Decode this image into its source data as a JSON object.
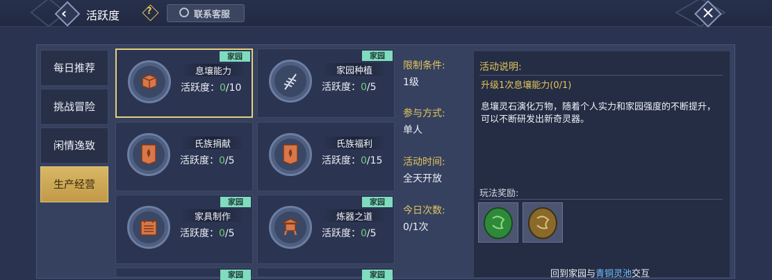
{
  "header": {
    "title": "活跃度",
    "contact_label": "联系客服"
  },
  "sidebar": {
    "tabs": [
      {
        "label": "每日推荐",
        "active": false
      },
      {
        "label": "挑战冒险",
        "active": false
      },
      {
        "label": "闲情逸致",
        "active": false
      },
      {
        "label": "生产经营",
        "active": true
      }
    ]
  },
  "activities": [
    {
      "name": "息壤能力",
      "progress_label": "活跃度：",
      "current": "0",
      "total": "/10",
      "tag": "家园",
      "icon": "box-icon",
      "selected": true
    },
    {
      "name": "家园种植",
      "progress_label": "活跃度：",
      "current": "0",
      "total": "/5",
      "tag": "家园",
      "icon": "wheat-icon",
      "selected": false
    },
    {
      "name": "氏族捐献",
      "progress_label": "活跃度：",
      "current": "0",
      "total": "/5",
      "tag": "",
      "icon": "banner-icon",
      "selected": false
    },
    {
      "name": "氏族福利",
      "progress_label": "活跃度：",
      "current": "0",
      "total": "/15",
      "tag": "",
      "icon": "banner-icon",
      "selected": false
    },
    {
      "name": "家具制作",
      "progress_label": "活跃度：",
      "current": "0",
      "total": "/5",
      "tag": "家园",
      "icon": "calendar-icon",
      "selected": false
    },
    {
      "name": "炼器之道",
      "progress_label": "活跃度：",
      "current": "0",
      "total": "/5",
      "tag": "家园",
      "icon": "furnace-icon",
      "selected": false
    },
    {
      "tag": "家园"
    },
    {
      "tag": "家园"
    }
  ],
  "info": {
    "limit_label": "限制条件:",
    "limit_value": "1级",
    "mode_label": "参与方式:",
    "mode_value": "单人",
    "time_label": "活动时间:",
    "time_value": "全天开放",
    "count_label": "今日次数:",
    "count_value": "0/1次"
  },
  "description": {
    "header": "活动说明:",
    "task": "升级1次息壤能力(0/1)",
    "body": "息壤灵石演化万物，随着个人实力和家园强度的不断提升，可以不断研发出新奇灵器。",
    "reward_header": "玩法奖励:",
    "rewards": [
      {
        "icon": "green-jade-icon",
        "color": "#2e8a3a"
      },
      {
        "icon": "bronze-jade-icon",
        "color": "#8a6a2a"
      }
    ],
    "footer_prefix": "回到家园与",
    "footer_highlight": "青铜灵池",
    "footer_suffix": "交互"
  },
  "colors": {
    "accent_gold": "#e3c65a",
    "progress_green": "#6fd27a",
    "tag_teal": "#7fdcbf",
    "active_tab": "#d1ad5a",
    "link_blue": "#6fc3ff"
  }
}
